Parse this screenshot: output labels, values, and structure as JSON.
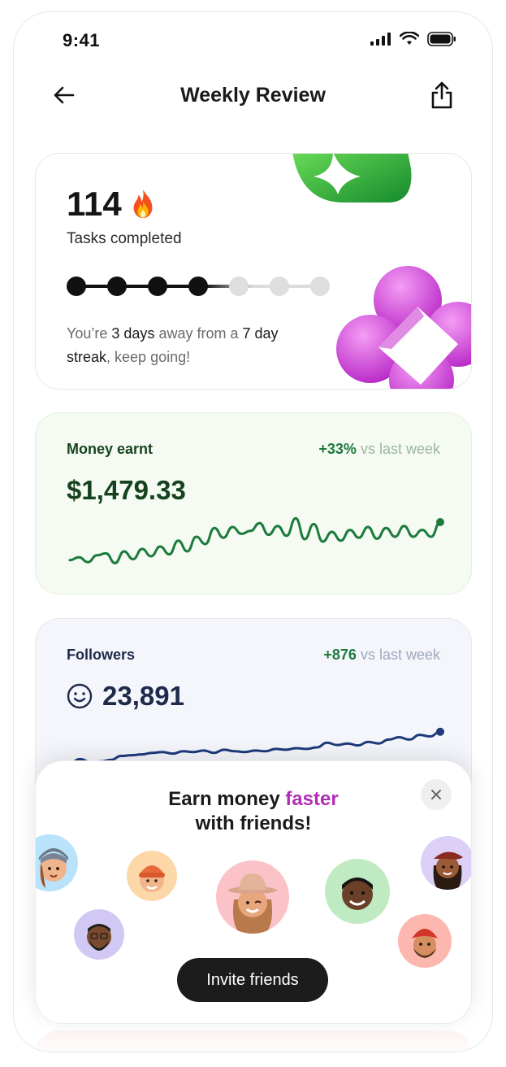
{
  "status_bar": {
    "time": "9:41"
  },
  "nav": {
    "title": "Weekly Review"
  },
  "streak_card": {
    "count": "114",
    "label": "Tasks completed",
    "days_total": 7,
    "days_done": 4,
    "text_prefix": "You’re ",
    "text_days": "3 days",
    "text_middle": " away from a ",
    "text_streak": "7 day streak",
    "text_suffix": ", keep going!"
  },
  "money_card": {
    "label": "Money earnt",
    "delta": "+33%",
    "delta_suffix": "vs last week",
    "value": "$1,479.33",
    "colors": {
      "accent": "#1d7a3d",
      "label": "#16421f",
      "muted": "#9cb59f"
    },
    "trend": [
      0.12,
      0.18,
      0.08,
      0.22,
      0.26,
      0.06,
      0.3,
      0.14,
      0.35,
      0.2,
      0.4,
      0.24,
      0.52,
      0.3,
      0.6,
      0.45,
      0.78,
      0.58,
      0.8,
      0.66,
      0.72,
      0.88,
      0.64,
      0.82,
      0.62,
      0.98,
      0.55,
      0.86,
      0.5,
      0.7,
      0.52,
      0.74,
      0.58,
      0.8,
      0.56,
      0.78,
      0.6,
      0.82,
      0.6,
      0.74,
      0.6,
      0.9
    ]
  },
  "followers_card": {
    "label": "Followers",
    "delta": "+876",
    "delta_suffix": "vs last week",
    "value": "23,891",
    "icon": "smiley-icon",
    "colors": {
      "accent": "#1d7a3d",
      "label": "#1e2a4a",
      "muted": "#a0a8bd",
      "line": "#1e3a7a"
    },
    "trend": [
      0.1,
      0.2,
      0.12,
      0.14,
      0.18,
      0.28,
      0.3,
      0.32,
      0.36,
      0.38,
      0.34,
      0.4,
      0.38,
      0.42,
      0.36,
      0.44,
      0.4,
      0.38,
      0.42,
      0.4,
      0.46,
      0.44,
      0.48,
      0.46,
      0.5,
      0.62,
      0.56,
      0.6,
      0.55,
      0.64,
      0.6,
      0.7,
      0.76,
      0.7,
      0.82,
      0.78,
      0.9
    ]
  },
  "popup": {
    "title_part1": "Earn money ",
    "title_accent": "faster",
    "title_part2": "with friends!",
    "invite_label": "Invite friends",
    "accent_color": "#b02fb5"
  }
}
